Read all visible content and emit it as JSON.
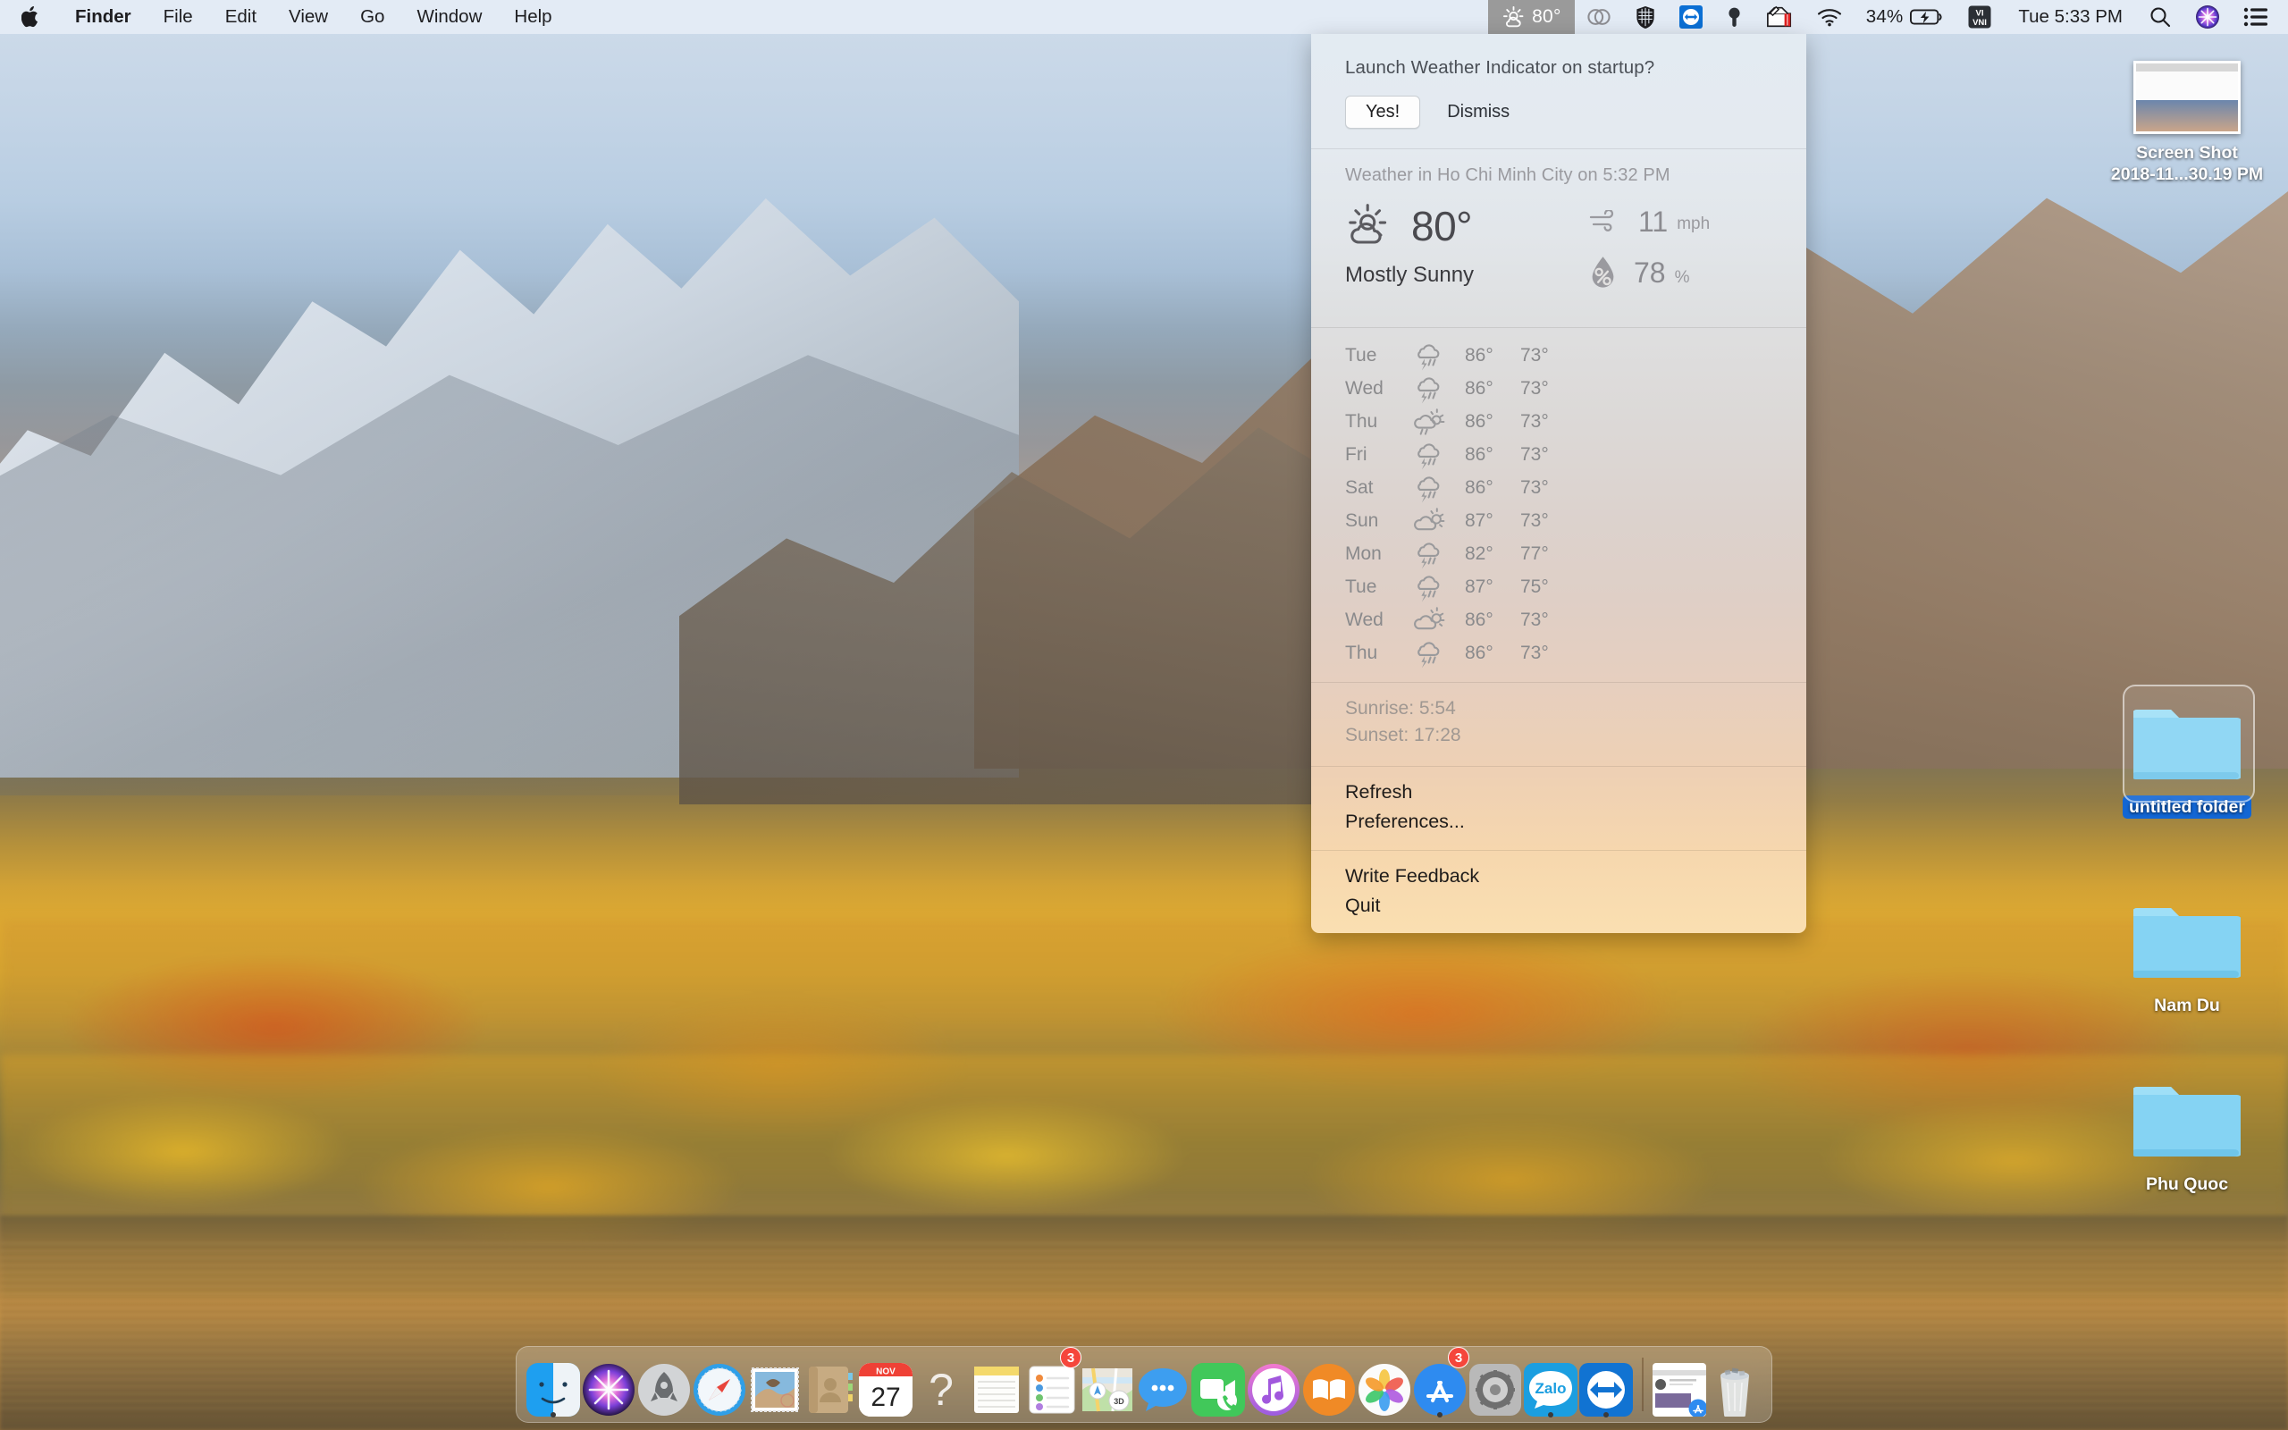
{
  "menubar": {
    "apple_icon": "apple-logo-icon",
    "items": [
      {
        "label": "Finder",
        "bold": true
      },
      {
        "label": "File",
        "bold": false
      },
      {
        "label": "Edit",
        "bold": false
      },
      {
        "label": "View",
        "bold": false
      },
      {
        "label": "Go",
        "bold": false
      },
      {
        "label": "Window",
        "bold": false
      },
      {
        "label": "Help",
        "bold": false
      }
    ],
    "status": {
      "weather_icon": "sun-behind-cloud-icon",
      "weather_temp": "80°",
      "creative_cloud_icon": "adobe-creative-cloud-icon",
      "shield_icon": "security-shield-icon",
      "teamviewer_icon": "teamviewer-arrows-icon",
      "pin_icon": "location-pin-icon",
      "toolbox_icon": "toolbox-icon",
      "wifi_icon": "wifi-icon",
      "battery_percent": "34%",
      "battery_icon": "battery-charging-icon",
      "input_source": "VI VNI",
      "clock": "Tue 5:33 PM",
      "search_icon": "spotlight-search-icon",
      "siri_icon": "siri-icon",
      "notification_center_icon": "notification-center-icon"
    },
    "accent_active_bg": "#9a9a9a"
  },
  "weather_panel": {
    "startup_prompt": {
      "question": "Launch Weather Indicator on startup?",
      "yes_label": "Yes!",
      "dismiss_label": "Dismiss"
    },
    "current": {
      "title": "Weather in Ho Chi Minh City on 5:32 PM",
      "condition_icon": "sun-behind-cloud-icon",
      "temperature": "80°",
      "condition": "Mostly Sunny",
      "wind_icon": "wind-icon",
      "wind_value": "11",
      "wind_unit": "mph",
      "humidity_icon": "humidity-droplet-icon",
      "humidity_value": "78",
      "humidity_unit": "%"
    },
    "forecast": [
      {
        "day": "Tue",
        "icon": "thunderstorm-icon",
        "high": "86°",
        "low": "73°"
      },
      {
        "day": "Wed",
        "icon": "thunderstorm-icon",
        "high": "86°",
        "low": "73°"
      },
      {
        "day": "Thu",
        "icon": "sun-behind-rain-cloud-icon",
        "high": "86°",
        "low": "73°"
      },
      {
        "day": "Fri",
        "icon": "thunderstorm-icon",
        "high": "86°",
        "low": "73°"
      },
      {
        "day": "Sat",
        "icon": "thunderstorm-icon",
        "high": "86°",
        "low": "73°"
      },
      {
        "day": "Sun",
        "icon": "sun-behind-cloud-icon",
        "high": "87°",
        "low": "73°"
      },
      {
        "day": "Mon",
        "icon": "thunderstorm-icon",
        "high": "82°",
        "low": "77°"
      },
      {
        "day": "Tue",
        "icon": "thunderstorm-icon",
        "high": "87°",
        "low": "75°"
      },
      {
        "day": "Wed",
        "icon": "sun-behind-cloud-icon",
        "high": "86°",
        "low": "73°"
      },
      {
        "day": "Thu",
        "icon": "thunderstorm-icon",
        "high": "86°",
        "low": "73°"
      }
    ],
    "sun": {
      "sunrise": "Sunrise: 5:54",
      "sunset": "Sunset: 17:28"
    },
    "actions": [
      {
        "label": "Refresh"
      },
      {
        "label": "Preferences..."
      }
    ],
    "footer_actions": [
      {
        "label": "Write Feedback"
      },
      {
        "label": "Quit"
      }
    ]
  },
  "desktop_icons": [
    {
      "name": "Screen Shot",
      "label_line1": "Screen Shot",
      "label_line2": "2018-11...30.19 PM",
      "type": "screenshot-file",
      "selected": false
    },
    {
      "name": "untitled folder",
      "label_line1": "untitled folder",
      "label_line2": "",
      "type": "folder",
      "selected": true
    },
    {
      "name": "Nam Du",
      "label_line1": "Nam Du",
      "label_line2": "",
      "type": "folder",
      "selected": false
    },
    {
      "name": "Phu Quoc",
      "label_line1": "Phu Quoc",
      "label_line2": "",
      "type": "folder",
      "selected": false
    }
  ],
  "dock": {
    "items": [
      {
        "name": "Finder",
        "icon": "finder-icon",
        "running": true,
        "badge": ""
      },
      {
        "name": "Siri",
        "icon": "siri-icon",
        "running": false,
        "badge": ""
      },
      {
        "name": "Launchpad",
        "icon": "launchpad-icon",
        "running": false,
        "badge": ""
      },
      {
        "name": "Safari",
        "icon": "safari-icon",
        "running": false,
        "badge": ""
      },
      {
        "name": "Mail",
        "icon": "mail-icon",
        "running": false,
        "badge": ""
      },
      {
        "name": "Contacts",
        "icon": "contacts-icon",
        "running": false,
        "badge": ""
      },
      {
        "name": "Calendar",
        "icon": "calendar-icon",
        "running": false,
        "badge": "",
        "month": "NOV",
        "day": "27"
      },
      {
        "name": "Help",
        "icon": "question-mark-icon",
        "running": false,
        "badge": ""
      },
      {
        "name": "Notes",
        "icon": "notes-icon",
        "running": false,
        "badge": ""
      },
      {
        "name": "Reminders",
        "icon": "reminders-icon",
        "running": false,
        "badge": "3"
      },
      {
        "name": "Maps",
        "icon": "maps-icon",
        "running": false,
        "badge": ""
      },
      {
        "name": "Messages",
        "icon": "messages-icon",
        "running": false,
        "badge": ""
      },
      {
        "name": "FaceTime",
        "icon": "facetime-icon",
        "running": false,
        "badge": ""
      },
      {
        "name": "iTunes",
        "icon": "itunes-icon",
        "running": false,
        "badge": ""
      },
      {
        "name": "iBooks",
        "icon": "ibooks-icon",
        "running": false,
        "badge": ""
      },
      {
        "name": "Photos",
        "icon": "photos-icon",
        "running": false,
        "badge": ""
      },
      {
        "name": "App Store",
        "icon": "app-store-icon",
        "running": true,
        "badge": "3"
      },
      {
        "name": "System Preferences",
        "icon": "system-preferences-icon",
        "running": false,
        "badge": ""
      },
      {
        "name": "Zalo",
        "icon": "zalo-icon",
        "running": true,
        "badge": "",
        "text": "Zalo"
      },
      {
        "name": "TeamViewer",
        "icon": "teamviewer-icon",
        "running": true,
        "badge": ""
      }
    ],
    "minimized": [
      {
        "name": "Screen Shot window",
        "icon": "minimized-window-icon"
      }
    ],
    "trash": {
      "name": "Trash",
      "icon": "trash-icon"
    }
  }
}
